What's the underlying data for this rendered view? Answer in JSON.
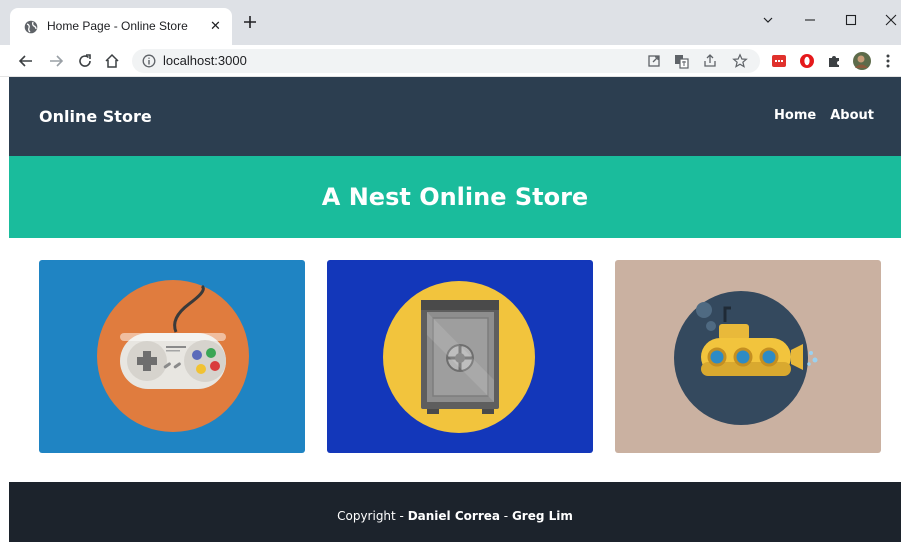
{
  "browser": {
    "tab": {
      "title": "Home Page - Online Store",
      "close_glyph": "✕"
    },
    "new_tab_icon": "plus-icon",
    "window_controls": [
      "chevron-down-icon",
      "minimize-icon",
      "maximize-icon",
      "close-icon"
    ],
    "toolbar": {
      "url": "localhost:3000",
      "nav_icons": [
        "back-arrow-icon",
        "forward-arrow-icon",
        "reload-icon",
        "home-icon"
      ],
      "omnibox_icons": [
        "open-in-new-icon",
        "translate-icon",
        "share-icon",
        "star-icon"
      ],
      "extensions": [
        "red-extension-icon",
        "opera-extension-icon",
        "puzzle-icon",
        "profile-avatar"
      ]
    }
  },
  "site": {
    "navbar": {
      "brand": "Online Store",
      "links": [
        {
          "label": "Home"
        },
        {
          "label": "About"
        }
      ]
    },
    "header": {
      "title": "A Nest Online Store"
    },
    "cards": [
      {
        "icon": "game-controller-icon",
        "bg": "#1f84c3",
        "circle": "#e07c3e"
      },
      {
        "icon": "safe-icon",
        "bg": "#1337ba",
        "circle": "#f2c43d"
      },
      {
        "icon": "submarine-icon",
        "bg": "#cab1a1",
        "circle": "#34495e"
      }
    ],
    "footer": {
      "prefix": "Copyright - ",
      "author1": "Daniel Correa",
      "separator": " - ",
      "author2": "Greg Lim"
    }
  },
  "colors": {
    "navbar_bg": "#2c3e50",
    "header_bg": "#1abc9c",
    "footer_bg": "#1c232c"
  }
}
